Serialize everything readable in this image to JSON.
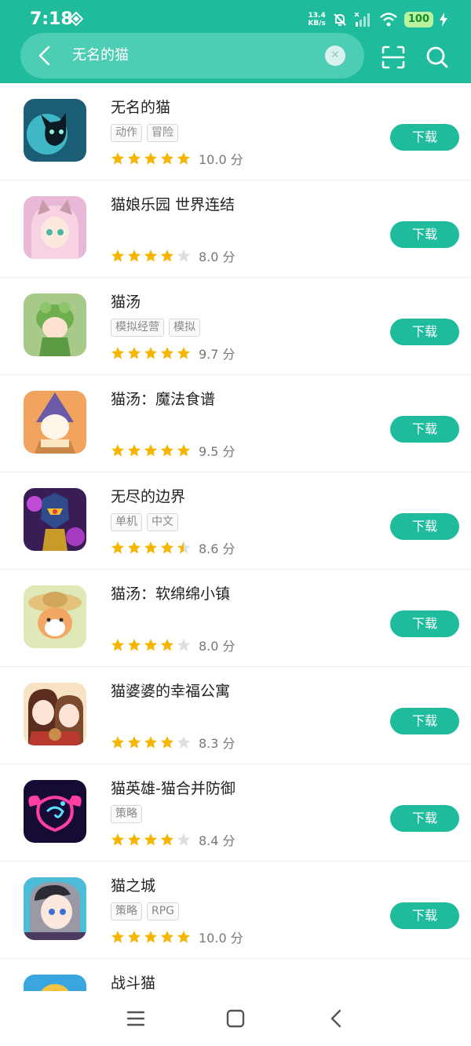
{
  "status": {
    "time": "7:18",
    "net_speed_value": "13.4",
    "net_speed_unit": "KB/s",
    "battery": "100"
  },
  "search": {
    "query": "无名的猫",
    "clear_icon": "close-icon"
  },
  "download_label": "下载",
  "score_unit": "分",
  "colors": {
    "accent": "#1ebc9c",
    "star": "#f7b500",
    "star_empty": "#dedede"
  },
  "apps": [
    {
      "title": "无名的猫",
      "tags": [
        "动作",
        "冒险"
      ],
      "rating": 5,
      "score": "10.0"
    },
    {
      "title": "猫娘乐园 世界连结",
      "tags": [],
      "rating": 4,
      "score": "8.0"
    },
    {
      "title": "猫汤",
      "tags": [
        "模拟经营",
        "模拟"
      ],
      "rating": 5,
      "score": "9.7"
    },
    {
      "title": "猫汤：魔法食谱",
      "tags": [],
      "rating": 5,
      "score": "9.5"
    },
    {
      "title": "无尽的边界",
      "tags": [
        "单机",
        "中文"
      ],
      "rating": 4.5,
      "score": "8.6"
    },
    {
      "title": "猫汤：软绵绵小镇",
      "tags": [],
      "rating": 4,
      "score": "8.0"
    },
    {
      "title": "猫婆婆的幸福公寓",
      "tags": [],
      "rating": 4,
      "score": "8.3"
    },
    {
      "title": "猫英雄-猫合并防御",
      "tags": [
        "策略"
      ],
      "rating": 4,
      "score": "8.4"
    },
    {
      "title": "猫之城",
      "tags": [
        "策略",
        "RPG"
      ],
      "rating": 5,
      "score": "10.0"
    },
    {
      "title": "战斗猫",
      "tags": [],
      "rating": 0,
      "score": ""
    }
  ]
}
